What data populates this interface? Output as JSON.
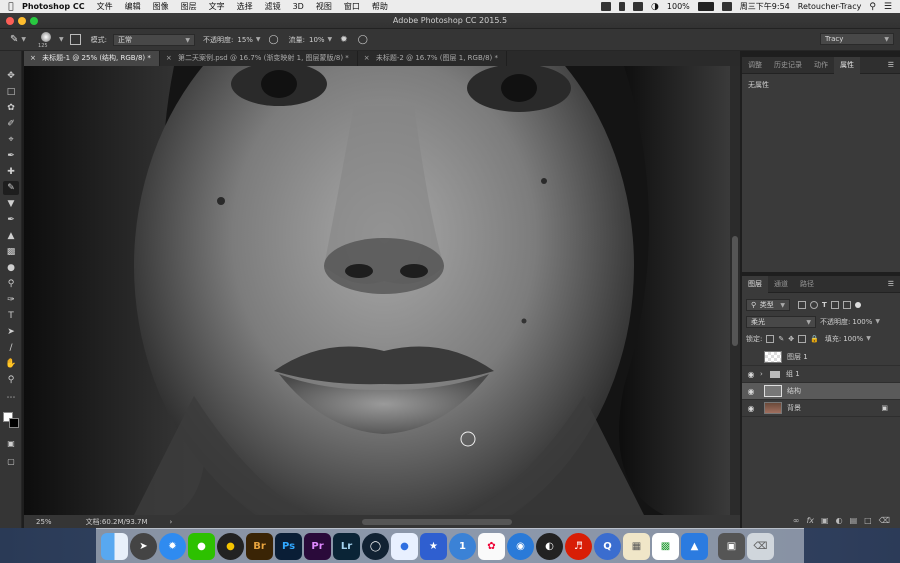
{
  "menubar": {
    "app_name": "Photoshop CC",
    "menus": [
      "文件",
      "编辑",
      "图像",
      "图层",
      "文字",
      "选择",
      "滤镜",
      "3D",
      "视图",
      "窗口",
      "帮助"
    ],
    "battery": "100%",
    "clock": "周三下午9:54",
    "user": "Retoucher-Tracy"
  },
  "window": {
    "title": "Adobe Photoshop CC 2015.5"
  },
  "options": {
    "brush_size": "125",
    "mode_label": "模式:",
    "mode_value": "正常",
    "opacity_label": "不透明度:",
    "opacity_value": "15%",
    "flow_label": "流量:",
    "flow_value": "10%",
    "workspace": "Tracy"
  },
  "tabs": [
    {
      "label": "未标题-1 @ 25% (结构, RGB/8) *",
      "active": true
    },
    {
      "label": "第二天案例.psd @ 16.7% (渐变映射 1, 图层蒙版/8) *",
      "active": false
    },
    {
      "label": "未标题-2 @ 16.7% (图层 1, RGB/8) *",
      "active": false
    }
  ],
  "status": {
    "zoom": "25%",
    "doc_info": "文档:60.2M/93.7M"
  },
  "panel_top": {
    "tabs": [
      "调整",
      "历史记录",
      "动作",
      "属性"
    ],
    "content": "无属性"
  },
  "layers_panel": {
    "tabs": [
      "图层",
      "通道",
      "路径"
    ],
    "filter_kind": "类型",
    "blend_mode": "柔光",
    "opacity_label": "不透明度:",
    "opacity_value": "100%",
    "lock_label": "锁定:",
    "fill_label": "填充:",
    "fill_value": "100%",
    "layers": [
      {
        "name": "图层 1",
        "visible": false,
        "type": "transparent"
      },
      {
        "name": "组 1",
        "visible": true,
        "type": "group"
      },
      {
        "name": "结构",
        "visible": true,
        "type": "gray",
        "selected": true
      },
      {
        "name": "背景",
        "visible": true,
        "type": "photo",
        "locked": true
      }
    ]
  },
  "dock": [
    "Finder",
    "Launchpad",
    "Safari",
    "WeChat",
    "QQ",
    "Br",
    "Ps",
    "Pr",
    "Lr",
    "Cinema",
    "Baidu",
    "Photos",
    "1Password",
    "Davinci",
    "NetEase",
    "OBS",
    "NetEase Music",
    "QuickTime",
    "Preview",
    "Numbers",
    "Keynote",
    "Screenshot",
    "Trash"
  ]
}
